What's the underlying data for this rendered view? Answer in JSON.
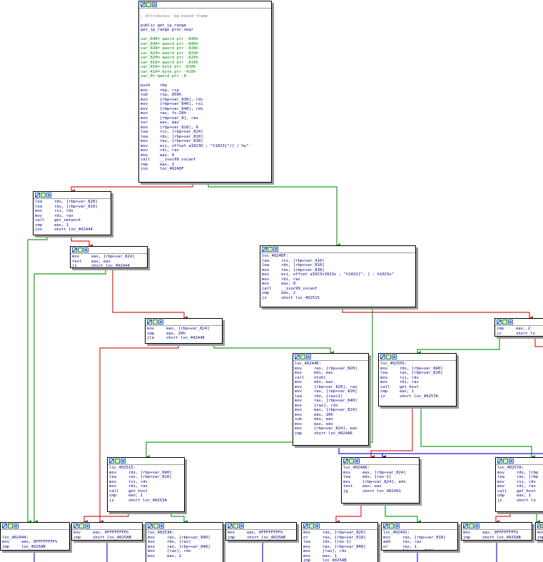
{
  "colors": {
    "edge_true": "#1aa01a",
    "edge_false": "#e02020",
    "edge_uncond": "#1a1ae0",
    "node_border": "#000000",
    "node_shadow": "#9a9a9a",
    "text": "#000082",
    "comment": "#7a7a7a",
    "var_ref": "#008800"
  },
  "header_icons": [
    "color-icon",
    "graph-icon",
    "list-icon"
  ],
  "nodes": {
    "main": {
      "lines": [
        "",
        "; Attributes: bp-based frame",
        "",
        "public get_ip_range",
        "get_ip_range proc near",
        "",
        "var_848= qword ptr -848h",
        "var_840= qword ptr -840h",
        "var_838= qword ptr -838h",
        "var_824= dword ptr -824h",
        "var_820= qword ptr -820h",
        "var_818= qword ptr -818h",
        "var_810= byte ptr -810h",
        "var_410= byte ptr -410h",
        "var_8= qword ptr -8",
        "",
        "push    rbp",
        "mov     rbp, rsp",
        "sub     rsp, 850h",
        "mov     [rbp+var_838], rdi",
        "mov     [rbp+var_840], rsi",
        "mov     [rbp+var_848], rdx",
        "mov     rax, fs:28h",
        "mov     [rbp+var_8], rax",
        "xor     eax, eax",
        "mov     [rbp+var_818], 0",
        "lea     rcx, [rbp+var_824]",
        "lea     rdx, [rbp+var_810]",
        "mov     rax, [rbp+var_838]",
        "mov     esi, offset a1023U ; \"%1023[^/] / %u\"",
        "mov     rdi, rax",
        "mov     eax, 0",
        "call    __isoc99_sscanf",
        "cmp     eax, 2",
        "jnz     loc_4024DF"
      ]
    },
    "n1": {
      "lines": [
        "lea     rdx, [rbp+var_820]",
        "lea     rax, [rbp+var_810]",
        "mov     rsi, rdx",
        "mov     rdi, rax",
        "call    get_network",
        "cmp     eax, 1",
        "jnz     short loc_402444"
      ]
    },
    "n2": {
      "lines": [
        "mov     eax, [rbp+var_824]",
        "test    eax, eax",
        "js      short loc_402444"
      ]
    },
    "n_4024DF": {
      "lines": [
        "loc_4024DF:",
        "lea     rcx, [rbp+var_410]",
        "lea     rdx, [rbp+var_810]",
        "mov     rax, [rbp+var_838]",
        "mov     esi, offset a1023i1023s ; \"%1023[^: ] : %1023s\"",
        "mov     rdi, rax",
        "mov     eax, 0",
        "call    __isoc99_sscanf",
        "cmp     eax, 2",
        "jz      short loc_402515"
      ]
    },
    "n3": {
      "lines": [
        "mov     eax, [rbp+var_824]",
        "cmp     eax, 20h",
        "jle     short loc_40244E"
      ]
    },
    "n_right_top": {
      "lines": [
        "cmp     eax, 2",
        "jz      short lo"
      ]
    },
    "n_40244E": {
      "lines": [
        "loc_40244E:",
        "mov     rax, [rbp+var_820]",
        "mov     edi, eax",
        "call    ntohl",
        "mov     edx, eax",
        "mov     [rbp+var_820], rax",
        "mov     rax, [rbp+var_820]",
        "lea     rdx, [rax+1]",
        "mov     rax, [rbp+var_840]",
        "mov     [rax], rdx",
        "mov     eax, [rbp+var_824]",
        "mov     edx, 20h",
        "sub     edx, eax",
        "mov     eax, edx",
        "mov     [rbp+var_824], eax",
        "jmp     short loc_4024A6"
      ]
    },
    "n_402555": {
      "lines": [
        "loc_402555:",
        "mov     rdx, [rbp+var_840]",
        "lea     rax, [rbp+var_810]",
        "mov     rsi, rdx",
        "mov     rdi, rax",
        "call    get_host",
        "cmp     eax, 1",
        "jz      short loc_40257A"
      ]
    },
    "n_402515": {
      "lines": [
        "loc_402515:",
        "mov     rdx, [rbp+var_840]",
        "lea     rax, [rbp+var_810]",
        "mov     rsi, rdx",
        "mov     rdi, rax",
        "call    get_host",
        "cmp     eax, 1",
        "jz      short loc_40253A"
      ]
    },
    "n_4024A6": {
      "lines": [
        "loc_4024A6:",
        "mov     eax, [rbp+var_824]",
        "lea     edx, [rax-1]",
        "mov     [rbp+var_824], edx",
        "test    eax, eax",
        "jg      short loc_402491"
      ]
    },
    "n_40257A": {
      "lines": [
        "loc_40257A:",
        "mov     rdx, [rbp",
        "lea     rax, [rbp",
        "mov     rsi, rdx",
        "mov     rdi, rax",
        "call    get_host",
        "cmp     eax, 1",
        "jz      short lo"
      ]
    },
    "n_402444": {
      "lines": [
        "",
        "loc_402444:",
        "mov     eax, 0FFFFFFFFh",
        "jmp     loc_4025AB"
      ]
    },
    "b1": {
      "lines": [
        "mov     eax, 0FFFFFFFFh",
        "jmp     short loc_4025AB"
      ]
    },
    "n_40253A": {
      "lines": [
        "loc_40253A:",
        "mov     rax, [rbp+var_840]",
        "mov     rdx, [rax]",
        "mov     rax, [rbp+var_848]",
        "mov     [rax], rdx",
        "mov     eax, 1"
      ]
    },
    "b2": {
      "lines": [
        "mov     eax, 0FFFFFFFFh",
        "jmp     short loc_4025AB"
      ]
    },
    "b3": {
      "lines": [
        "mov     rax, [rbp+var_820]",
        "or      rax, [rbp+var_818]",
        "lea     rdx, [rax-1]",
        "mov     rax, [rbp+var_848]",
        "mov     [rax], rdx",
        "mov     eax, 1",
        "jmp     loc_4025AB"
      ]
    },
    "n_402491": {
      "lines": [
        "loc_402491:",
        "mov     rax, [rbp+var_818]",
        "add     rax, rax",
        "or      rax, 1",
        "mov     [rbp+var_818], rax"
      ]
    },
    "b4": {
      "lines": [
        "mov     eax, 0FFFFFFFFh",
        "jmp     short loc_4025AB"
      ]
    },
    "b5": {
      "lines": [
        "mov     eax,",
        "jmp     short lo"
      ]
    }
  }
}
